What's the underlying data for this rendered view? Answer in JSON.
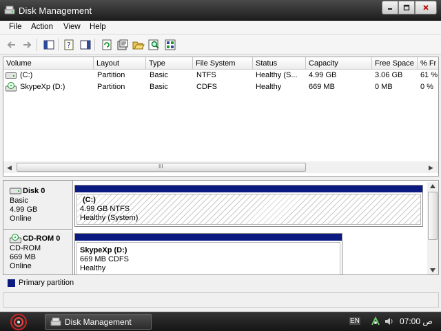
{
  "window": {
    "title": "Disk Management",
    "buttons": {
      "minimize_icon": "minimize-icon",
      "maximize_icon": "maximize-icon",
      "close_icon": "close-icon"
    }
  },
  "menu": [
    {
      "label": "File"
    },
    {
      "label": "Action"
    },
    {
      "label": "View"
    },
    {
      "label": "Help"
    }
  ],
  "toolbar": {
    "icons": [
      "back-arrow-icon",
      "forward-arrow-icon",
      "show-hide-console-tree-icon",
      "help-icon",
      "show-hide-action-pane-icon",
      "refresh-icon",
      "properties-icon",
      "open-folder-icon",
      "search-icon",
      "rescan-disks-icon"
    ]
  },
  "volume_list": {
    "columns": [
      "Volume",
      "Layout",
      "Type",
      "File System",
      "Status",
      "Capacity",
      "Free Space",
      "% Fr"
    ],
    "rows": [
      {
        "volume": "(C:)",
        "layout": "Partition",
        "type": "Basic",
        "file_system": "NTFS",
        "status": "Healthy (S...",
        "capacity": "4.99 GB",
        "free_space": "3.06 GB",
        "pct_free": "61 %"
      },
      {
        "volume": "SkypeXp (D:)",
        "layout": "Partition",
        "type": "Basic",
        "file_system": "CDFS",
        "status": "Healthy",
        "capacity": "669 MB",
        "free_space": "0 MB",
        "pct_free": "0 %"
      }
    ],
    "scroll_grip": "III"
  },
  "disks": [
    {
      "name": "Disk 0",
      "kind": "Basic",
      "size": "4.99 GB",
      "state": "Online",
      "volume": {
        "label": "(C:)",
        "detail": "4.99 GB NTFS",
        "status": "Healthy (System)"
      }
    },
    {
      "name": "CD-ROM 0",
      "kind": "CD-ROM",
      "size": "669 MB",
      "state": "Online",
      "volume": {
        "label": "SkypeXp  (D:)",
        "detail": "669 MB CDFS",
        "status": "Healthy"
      }
    }
  ],
  "legend": {
    "primary_partition": "Primary partition",
    "color": "#0a1a80"
  },
  "taskbar": {
    "task_label": "Disk Management",
    "language": "EN",
    "clock": "07:00 ص"
  }
}
